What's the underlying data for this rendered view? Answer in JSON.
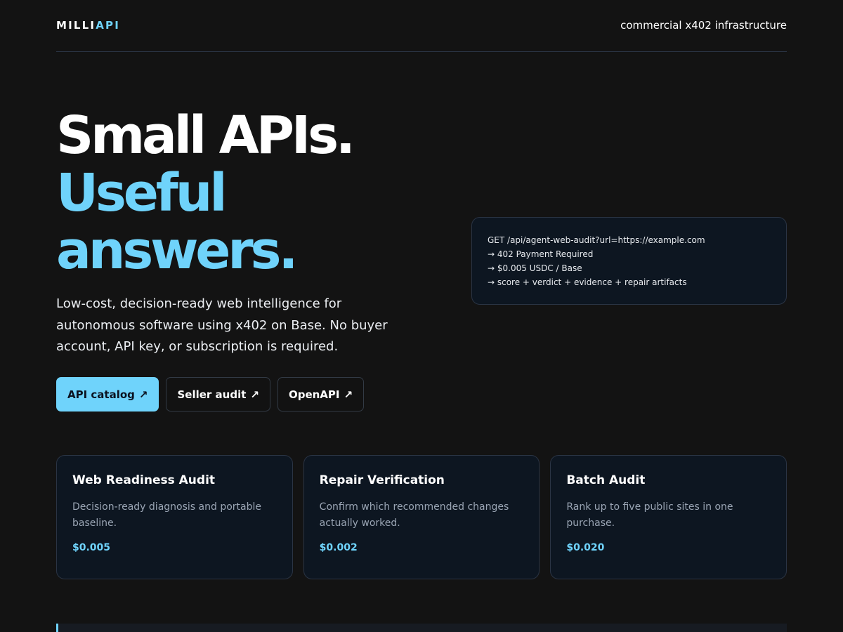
{
  "header": {
    "logo_main": "MILLI",
    "logo_accent": "API",
    "tagline": "commercial x402 infrastructure"
  },
  "hero": {
    "title_line1": "Small APIs.",
    "title_line2a": "Useful",
    "title_line2b": "answers.",
    "description": "Low-cost, decision-ready web intelligence for autonomous software using x402 on Base. No buyer account, API key, or subscription is required."
  },
  "buttons": [
    {
      "label": "API catalog",
      "icon": "external-arrow-icon"
    },
    {
      "label": "Seller audit",
      "icon": "external-arrow-icon"
    },
    {
      "label": "OpenAPI",
      "icon": "external-arrow-icon"
    }
  ],
  "code_example": {
    "lines": [
      "GET /api/agent-web-audit?url=https://example.com",
      "→ 402 Payment Required",
      "→ $0.005 USDC / Base",
      "→ score + verdict + evidence + repair artifacts"
    ]
  },
  "cards": [
    {
      "title": "Web Readiness Audit",
      "description": "Decision-ready diagnosis and portable baseline.",
      "price": "$0.005"
    },
    {
      "title": "Repair Verification",
      "description": "Confirm which recommended changes actually worked.",
      "price": "$0.002"
    },
    {
      "title": "Batch Audit",
      "description": "Rank up to five public sites in one purchase.",
      "price": "$0.020"
    }
  ],
  "colors": {
    "background": "#131313",
    "accent": "#6fd3fb",
    "card_bg": "#0d1621",
    "border": "#2a3444"
  }
}
